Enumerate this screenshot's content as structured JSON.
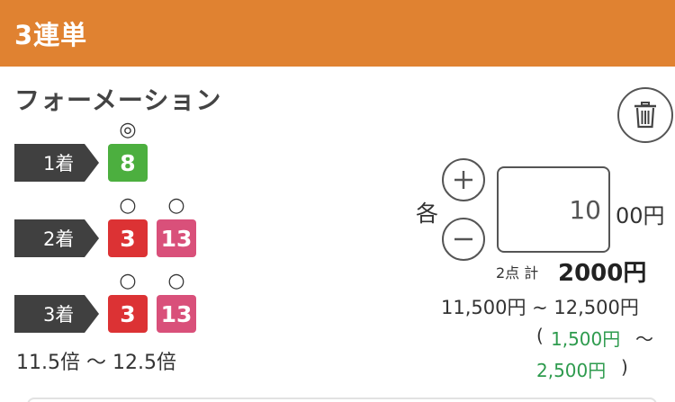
{
  "header": {
    "title": "3連単"
  },
  "bet": {
    "type_label": "フォーメーション",
    "rows": [
      {
        "label": "1着",
        "picks": [
          {
            "mark": "◎",
            "number": "8",
            "color": "#4CAF3F"
          }
        ]
      },
      {
        "label": "2着",
        "picks": [
          {
            "mark": "○",
            "number": "3",
            "color": "#DC3234"
          },
          {
            "mark": "○",
            "number": "13",
            "color": "#D9507A"
          }
        ]
      },
      {
        "label": "3着",
        "picks": [
          {
            "mark": "○",
            "number": "3",
            "color": "#DC3234"
          },
          {
            "mark": "○",
            "number": "13",
            "color": "#D9507A"
          }
        ]
      }
    ],
    "odds_range": "11.5倍 ～ 12.5倍"
  },
  "amount": {
    "each_label": "各",
    "value": "10",
    "unit": "00円",
    "points": "2点 計",
    "total": "2000円",
    "payout_range": "11,500円 ~ 12,500円",
    "profit_open": "(",
    "profit_min": "1,500円",
    "profit_sep": "～",
    "profit_max": "2,500円",
    "profit_close": ")"
  },
  "icons": {
    "trash": "trash-icon",
    "plus": "plus-icon",
    "minus": "minus-icon"
  },
  "colors": {
    "header": "#E08231",
    "profit": "#2E9B4E"
  }
}
